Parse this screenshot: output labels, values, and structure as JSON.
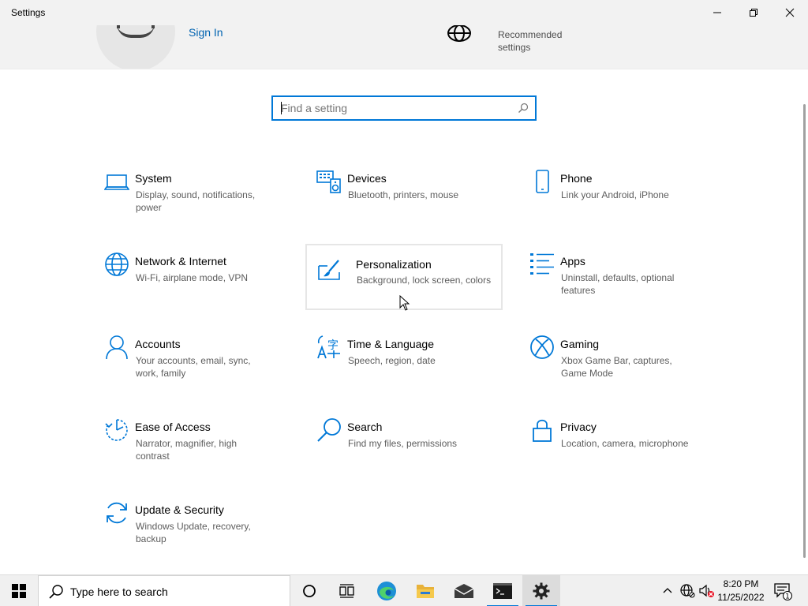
{
  "window": {
    "title": "Settings",
    "controls": [
      "minimize",
      "maximize",
      "close"
    ]
  },
  "header": {
    "sign_in": "Sign In",
    "recommended": "Recommended settings"
  },
  "search": {
    "placeholder": "Find a setting",
    "value": ""
  },
  "tiles": [
    {
      "name": "System",
      "desc": "Display, sound, notifications, power",
      "icon": "laptop-icon"
    },
    {
      "name": "Devices",
      "desc": "Bluetooth, printers, mouse",
      "icon": "keyboard-speaker-icon"
    },
    {
      "name": "Phone",
      "desc": "Link your Android, iPhone",
      "icon": "phone-icon"
    },
    {
      "name": "Network & Internet",
      "desc": "Wi-Fi, airplane mode, VPN",
      "icon": "globe-icon"
    },
    {
      "name": "Personalization",
      "desc": "Background, lock screen, colors",
      "icon": "paint-brush-icon"
    },
    {
      "name": "Apps",
      "desc": "Uninstall, defaults, optional features",
      "icon": "apps-list-icon"
    },
    {
      "name": "Accounts",
      "desc": "Your accounts, email, sync, work, family",
      "icon": "person-icon"
    },
    {
      "name": "Time & Language",
      "desc": "Speech, region, date",
      "icon": "time-language-icon"
    },
    {
      "name": "Gaming",
      "desc": "Xbox Game Bar, captures, Game Mode",
      "icon": "xbox-icon"
    },
    {
      "name": "Ease of Access",
      "desc": "Narrator, magnifier, high contrast",
      "icon": "ease-of-access-icon"
    },
    {
      "name": "Search",
      "desc": "Find my files, permissions",
      "icon": "search-icon"
    },
    {
      "name": "Privacy",
      "desc": "Location, camera, microphone",
      "icon": "lock-icon"
    },
    {
      "name": "Update & Security",
      "desc": "Windows Update, recovery, backup",
      "icon": "sync-icon"
    }
  ],
  "taskbar": {
    "search_placeholder": "Type here to search",
    "pinned": [
      "cortana-icon",
      "task-view-icon",
      "edge-icon",
      "file-explorer-icon",
      "mail-icon",
      "terminal-icon",
      "settings-icon"
    ],
    "active": "settings-icon",
    "time": "8:20 PM",
    "date": "11/25/2022",
    "notification_count": "1"
  },
  "colors": {
    "accent": "#0078d7",
    "link": "#0063b1",
    "header_bg": "#f2f2f2",
    "taskbar_bg": "#f0f0f0"
  }
}
